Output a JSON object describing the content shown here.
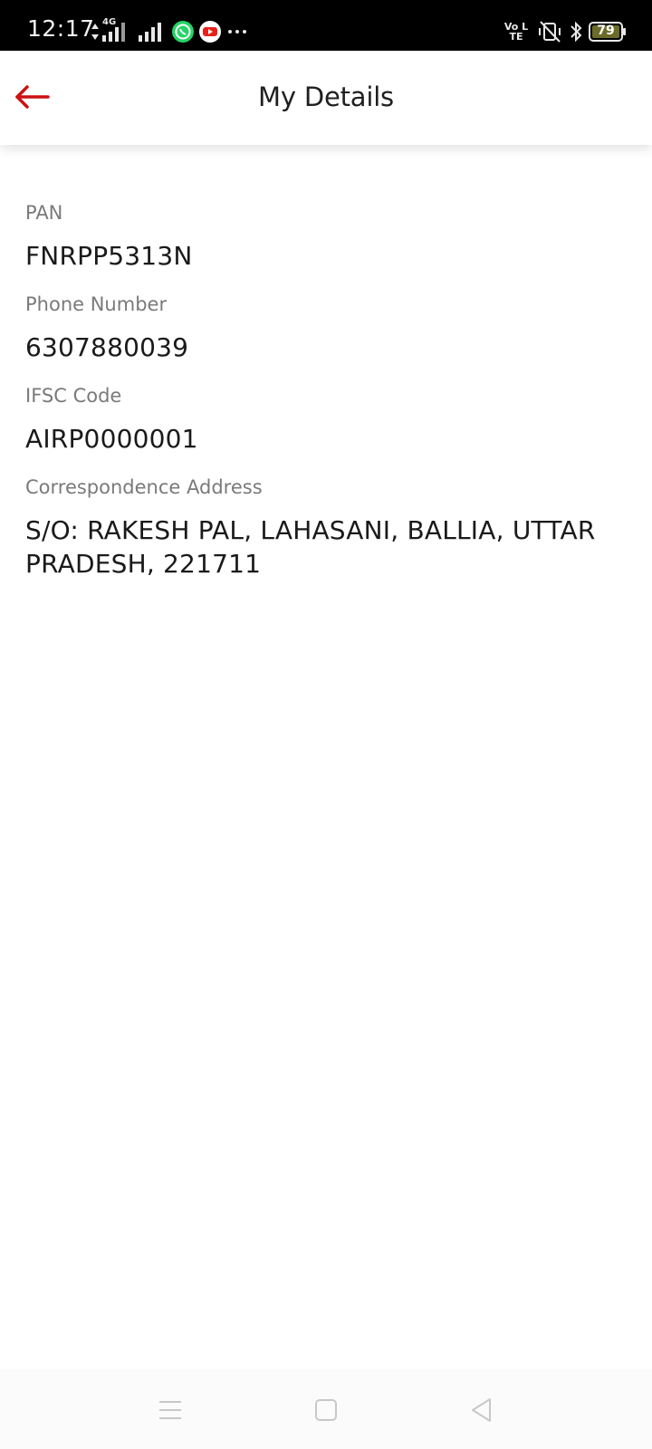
{
  "status_bar": {
    "time": "12:17",
    "network_type": "4G",
    "volte_label": "Vo LTE",
    "battery_level": "79",
    "icons": [
      "data-arrows-icon",
      "signal-icon",
      "signal-icon",
      "whatsapp-icon",
      "youtube-icon",
      "more-dots-icon",
      "volte-icon",
      "vibrate-icon",
      "bluetooth-icon",
      "battery-icon"
    ]
  },
  "header": {
    "title": "My Details",
    "back_icon": "back-arrow-icon",
    "accent_color": "#cc1111"
  },
  "details": {
    "pan": {
      "label": "PAN",
      "value": "FNRPP5313N"
    },
    "phone": {
      "label": "Phone Number",
      "value": "6307880039"
    },
    "ifsc": {
      "label": "IFSC Code",
      "value": "AIRP0000001"
    },
    "address": {
      "label": "Correspondence Address",
      "value": "S/O: RAKESH PAL, LAHASANI, BALLIA, UTTAR PRADESH, 221711"
    }
  },
  "nav_bar": {
    "icons": [
      "menu-icon",
      "home-square-icon",
      "back-triangle-icon"
    ]
  }
}
